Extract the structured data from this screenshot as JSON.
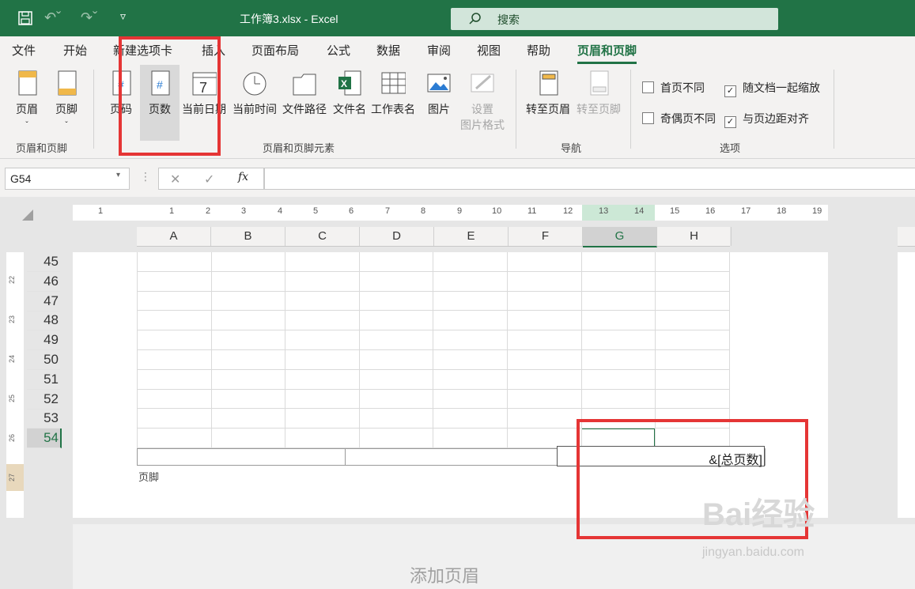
{
  "titlebar": {
    "file_title": "工作簿3.xlsx  -  Excel",
    "search_label": "搜索",
    "colors": {
      "bg": "#217346"
    }
  },
  "tabs": [
    {
      "label": "文件"
    },
    {
      "label": "开始"
    },
    {
      "label": "新建选项卡"
    },
    {
      "label": "插入"
    },
    {
      "label": "页面布局"
    },
    {
      "label": "公式"
    },
    {
      "label": "数据"
    },
    {
      "label": "审阅"
    },
    {
      "label": "视图"
    },
    {
      "label": "帮助"
    },
    {
      "label": "页眉和页脚",
      "active": true
    }
  ],
  "ribbon": {
    "group1": {
      "label": "页眉和页脚",
      "buttons": [
        {
          "label": "页眉"
        },
        {
          "label": "页脚"
        }
      ]
    },
    "group2": {
      "label": "页眉和页脚元素",
      "buttons": [
        {
          "label": "页码"
        },
        {
          "label": "页数"
        },
        {
          "label": "当前日期"
        },
        {
          "label": "当前时间"
        },
        {
          "label": "文件路径"
        },
        {
          "label": "文件名"
        },
        {
          "label": "工作表名"
        },
        {
          "label": "图片"
        },
        {
          "label": "设置"
        },
        {
          "label": "图片格式"
        }
      ]
    },
    "group3": {
      "label": "导航",
      "buttons": [
        {
          "label": "转至页眉"
        },
        {
          "label": "转至页脚"
        }
      ]
    },
    "group4": {
      "label": "选项",
      "options": [
        {
          "label": "首页不同",
          "checked": false
        },
        {
          "label": "随文档一起缩放",
          "checked": true
        },
        {
          "label": "奇偶页不同",
          "checked": false
        },
        {
          "label": "与页边距对齐",
          "checked": true
        }
      ]
    }
  },
  "formula_bar": {
    "name_box": "G54",
    "fx": "fx",
    "cancel": "✕",
    "enter": "✓"
  },
  "ruler_ticks": [
    "1",
    "1",
    "2",
    "3",
    "4",
    "5",
    "6",
    "7",
    "8",
    "9",
    "10",
    "11",
    "12",
    "13",
    "14",
    "15",
    "16",
    "17",
    "18",
    "19"
  ],
  "columns": [
    "A",
    "B",
    "C",
    "D",
    "E",
    "F",
    "G",
    "H"
  ],
  "selected_column": "G",
  "rows": [
    "45",
    "46",
    "47",
    "48",
    "49",
    "50",
    "51",
    "52",
    "53",
    "54"
  ],
  "selected_row": "54",
  "vruler_ticks": [
    "22",
    "23",
    "24",
    "25",
    "26",
    "27"
  ],
  "footer": {
    "right_section": "&[总页数]",
    "label": "页脚"
  },
  "add_header": "添加页眉",
  "watermark": {
    "brand": "Bai经验",
    "url": "jingyan.baidu.com"
  }
}
